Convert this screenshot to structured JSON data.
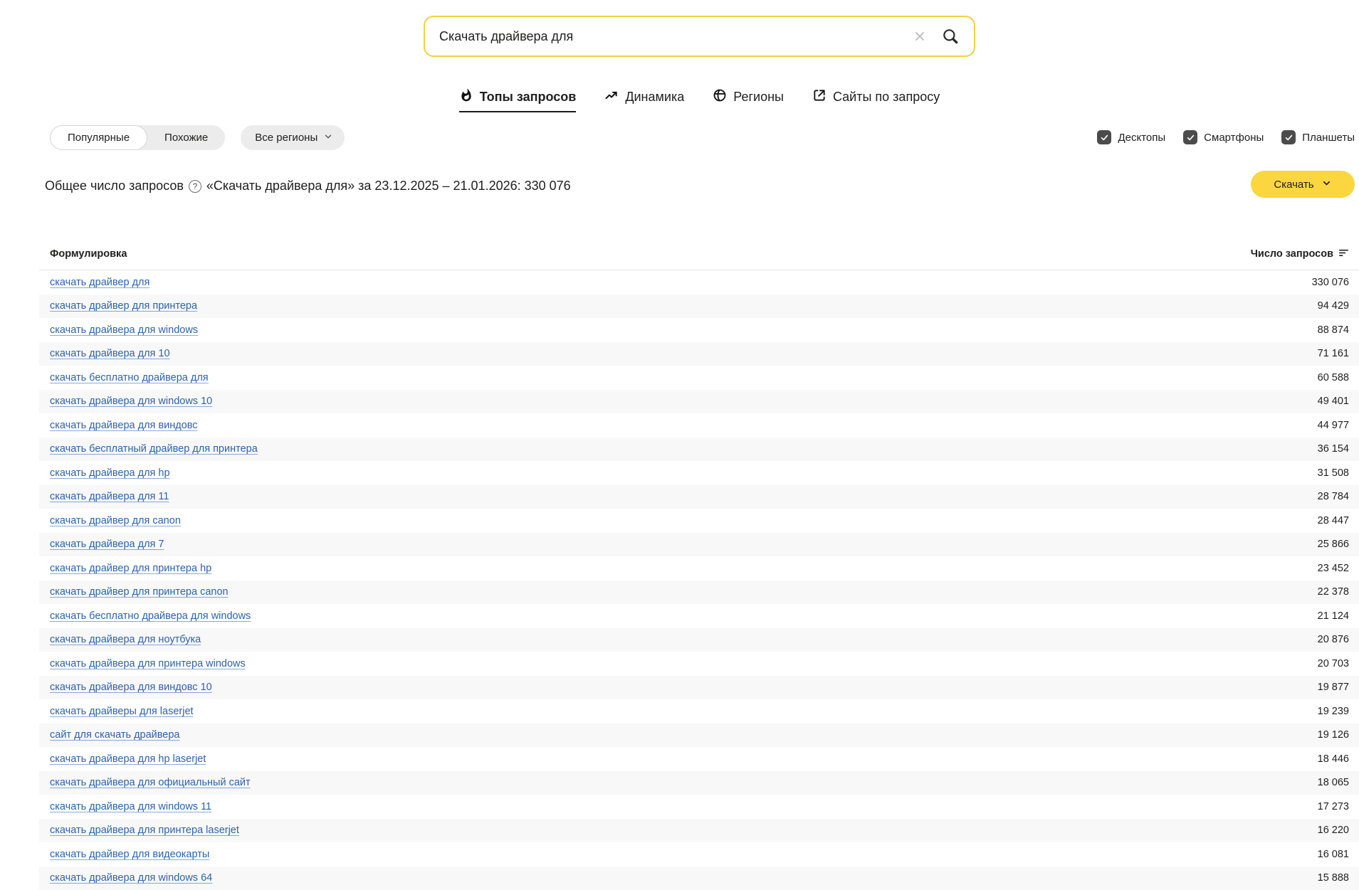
{
  "search": {
    "value": "Скачать драйвера для",
    "border_color": "#f2d23f"
  },
  "tabs": [
    {
      "label": "Топы запросов",
      "icon": "fire-icon",
      "active": true
    },
    {
      "label": "Динамика",
      "icon": "trend-icon",
      "active": false
    },
    {
      "label": "Регионы",
      "icon": "globe-icon",
      "active": false
    },
    {
      "label": "Сайты по запросу",
      "icon": "external-link-icon",
      "active": false
    }
  ],
  "filters": {
    "segments": [
      {
        "label": "Популярные",
        "selected": true
      },
      {
        "label": "Похожие",
        "selected": false
      }
    ],
    "region_selector": "Все регионы",
    "device_checkboxes": [
      {
        "label": "Десктопы",
        "checked": true
      },
      {
        "label": "Смартфоны",
        "checked": true
      },
      {
        "label": "Планшеты",
        "checked": true
      }
    ]
  },
  "summary": {
    "prefix": "Общее число запросов",
    "rest": "«Скачать драйвера для» за 23.12.2025 – 21.01.2026: 330 076",
    "help_glyph": "?"
  },
  "download_button": {
    "label": "Скачать"
  },
  "table": {
    "columns": {
      "query": "Формулировка",
      "count": "Число запросов"
    },
    "rows": [
      {
        "query": "скачать драйвер для",
        "count": "330 076"
      },
      {
        "query": "скачать драйвер для принтера",
        "count": "94 429"
      },
      {
        "query": "скачать драйвера для windows",
        "count": "88 874"
      },
      {
        "query": "скачать драйвера для 10",
        "count": "71 161"
      },
      {
        "query": "скачать бесплатно драйвера для",
        "count": "60 588"
      },
      {
        "query": "скачать драйвера для windows 10",
        "count": "49 401"
      },
      {
        "query": "скачать драйвера для виндовс",
        "count": "44 977"
      },
      {
        "query": "скачать бесплатный драйвер для принтера",
        "count": "36 154"
      },
      {
        "query": "скачать драйвера для hp",
        "count": "31 508"
      },
      {
        "query": "скачать драйвера для 11",
        "count": "28 784"
      },
      {
        "query": "скачать драйвер для canon",
        "count": "28 447"
      },
      {
        "query": "скачать драйвера для 7",
        "count": "25 866"
      },
      {
        "query": "скачать драйвер для принтера hp",
        "count": "23 452"
      },
      {
        "query": "скачать драйвер для принтера canon",
        "count": "22 378"
      },
      {
        "query": "скачать бесплатно драйвера для windows",
        "count": "21 124"
      },
      {
        "query": "скачать драйвера для ноутбука",
        "count": "20 876"
      },
      {
        "query": "скачать драйвера для принтера windows",
        "count": "20 703"
      },
      {
        "query": "скачать драйвера для виндовс 10",
        "count": "19 877"
      },
      {
        "query": "скачать драйверы для laserjet",
        "count": "19 239"
      },
      {
        "query": "сайт для скачать драйвера",
        "count": "19 126"
      },
      {
        "query": "скачать драйвера для hp laserjet",
        "count": "18 446"
      },
      {
        "query": "скачать драйвера для официальный сайт",
        "count": "18 065"
      },
      {
        "query": "скачать драйвера для windows 11",
        "count": "17 273"
      },
      {
        "query": "скачать драйвера для принтера laserjet",
        "count": "16 220"
      },
      {
        "query": "скачать драйвер для видеокарты",
        "count": "16 081"
      },
      {
        "query": "скачать драйвера для windows 64",
        "count": "15 888"
      }
    ]
  },
  "colors": {
    "accent_yellow": "#fbd63e",
    "search_border": "#f2d23f",
    "link_blue": "#2b62b0",
    "row_alt": "#f8f8f8",
    "checkbox_dark": "#4b4b4b"
  }
}
